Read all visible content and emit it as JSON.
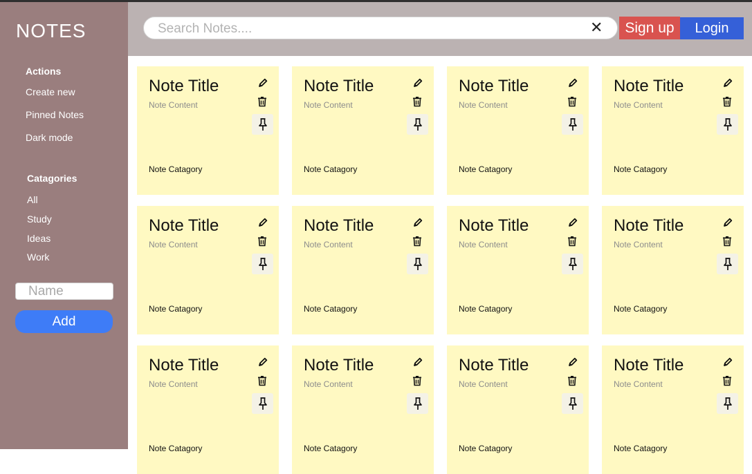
{
  "app": {
    "title": "NOTES"
  },
  "sidebar": {
    "actions_title": "Actions",
    "actions": [
      {
        "label": "Create new"
      },
      {
        "label": "Pinned Notes"
      },
      {
        "label": "Dark mode"
      }
    ],
    "categories_title": "Catagories",
    "categories": [
      {
        "label": "All"
      },
      {
        "label": "Study"
      },
      {
        "label": "Ideas"
      },
      {
        "label": "Work"
      }
    ],
    "name_placeholder": "Name",
    "add_label": "Add"
  },
  "header": {
    "search_placeholder": "Search Notes....",
    "clear_glyph": "✕",
    "signup_label": "Sign up",
    "login_label": "Login"
  },
  "notes": [
    {
      "title": "Note Title",
      "content": "Note Content",
      "category": "Note Catagory"
    },
    {
      "title": "Note Title",
      "content": "Note Content",
      "category": "Note Catagory"
    },
    {
      "title": "Note Title",
      "content": "Note Content",
      "category": "Note Catagory"
    },
    {
      "title": "Note Title",
      "content": "Note Content",
      "category": "Note Catagory"
    },
    {
      "title": "Note Title",
      "content": "Note Content",
      "category": "Note Catagory"
    },
    {
      "title": "Note Title",
      "content": "Note Content",
      "category": "Note Catagory"
    },
    {
      "title": "Note Title",
      "content": "Note Content",
      "category": "Note Catagory"
    },
    {
      "title": "Note Title",
      "content": "Note Content",
      "category": "Note Catagory"
    },
    {
      "title": "Note Title",
      "content": "Note Content",
      "category": "Note Catagory"
    },
    {
      "title": "Note Title",
      "content": "Note Content",
      "category": "Note Catagory"
    },
    {
      "title": "Note Title",
      "content": "Note Content",
      "category": "Note Catagory"
    },
    {
      "title": "Note Title",
      "content": "Note Content",
      "category": "Note Catagory"
    }
  ],
  "icons": {
    "edit": "pencil-icon",
    "delete": "trash-icon",
    "pin": "pin-icon",
    "clear": "close-icon"
  },
  "colors": {
    "sidebar": "#9a7e7e",
    "header": "#bbb2b2",
    "note": "#fff9c2",
    "add_button": "#3e7cf7",
    "signup": "#d9534f",
    "login": "#3560d8"
  }
}
